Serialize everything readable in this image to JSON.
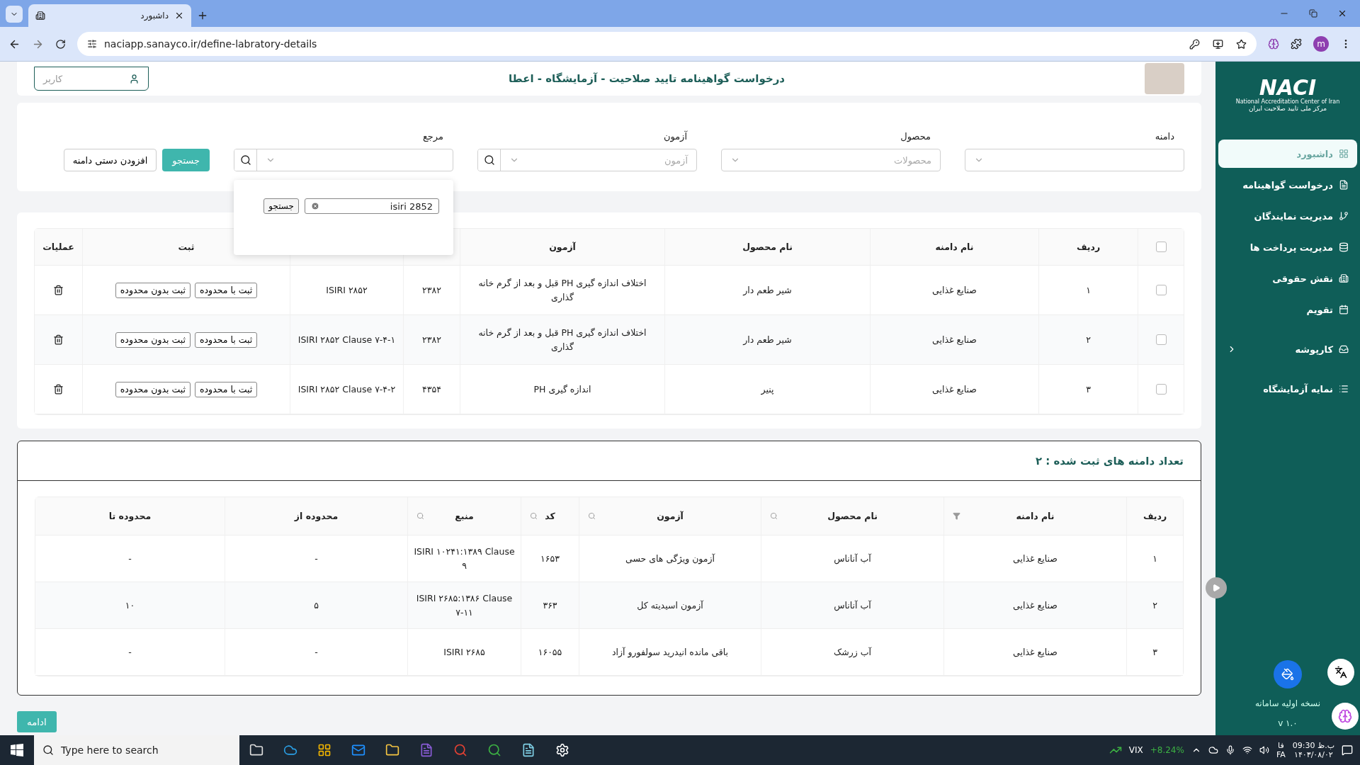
{
  "browser": {
    "tab_title": "داشبورد",
    "url": "naciapp.sanayco.ir/define-labratory-details",
    "profile_initial": "m"
  },
  "header": {
    "user_field": {
      "placeholder": "کاربر"
    },
    "title": "درخواست گواهینامه تایید صلاحیت - آزمایشگاه - اعطا"
  },
  "filters": {
    "fields": [
      {
        "label": "دامنه",
        "kind": "select"
      },
      {
        "label": "محصول",
        "kind": "select",
        "placeholder": "محصولات"
      },
      {
        "label": "آزمون",
        "kind": "search-select",
        "placeholder": "آزمون"
      },
      {
        "label": "مرجع",
        "kind": "search-select",
        "popup": {
          "value": "isiri 2852",
          "button": "جستجو"
        }
      }
    ],
    "search_button": "جستجو",
    "add_button": "افزودن دستی دامنه"
  },
  "domains_table": {
    "header_checked": false,
    "columns": [
      "ردیف",
      "نام دامنه",
      "نام محصول",
      "آزمون",
      null,
      null,
      "ثبت",
      "عملیات"
    ],
    "rows": [
      {
        "checked": false,
        "number": "۱",
        "domain": "صنایع غذایی",
        "product": "شیر طعم دار",
        "test": "اختلاف اندازه گیری PH قبل و بعد از گرم خانه گذاری",
        "code": "۲۳۸۲",
        "source": "ISIRI ۲۸۵۲",
        "buttons": [
          "ثبت با محدوده",
          "ثبت بدون محدوده"
        ]
      },
      {
        "checked": false,
        "number": "۲",
        "domain": "صنایع غذایی",
        "product": "شیر طعم دار",
        "test": "اختلاف اندازه گیری PH قبل و بعد از گرم خانه گذاری",
        "code": "۲۳۸۲",
        "source": "ISIRI ۲۸۵۲ Clause ۷-۴-۱",
        "buttons": [
          "ثبت با محدوده",
          "ثبت بدون محدوده"
        ]
      },
      {
        "checked": false,
        "number": "۳",
        "domain": "صنایع غذایی",
        "product": "پنیر",
        "test": "اندازه گیری PH",
        "code": "۴۳۵۴",
        "source": "ISIRI ۲۸۵۲ Clause ۷-۴-۲",
        "buttons": [
          "ثبت با محدوده",
          "ثبت بدون محدوده"
        ]
      }
    ]
  },
  "registered": {
    "title": "تعداد دامنه های ثبت شده : ۲",
    "columns": [
      {
        "label": "ردیف",
        "searchable": false,
        "filterable": false
      },
      {
        "label": "نام دامنه",
        "searchable": false,
        "filterable": true
      },
      {
        "label": "نام محصول",
        "searchable": true,
        "filterable": false
      },
      {
        "label": "آزمون",
        "searchable": true,
        "filterable": false
      },
      {
        "label": "کد",
        "searchable": true,
        "filterable": false
      },
      {
        "label": "منبع",
        "searchable": true,
        "filterable": false
      },
      {
        "label": "محدوده از",
        "searchable": false,
        "filterable": false
      },
      {
        "label": "محدوده تا",
        "searchable": false,
        "filterable": false
      }
    ],
    "rows": [
      [
        "۱",
        "صنایع غذایی",
        "آب آناناس",
        "آزمون ویژگی های حسی",
        "۱۶۵۳",
        "ISIRI ۱۰۲۴۱:۱۳۸۹ Clause ۹",
        "-",
        "-"
      ],
      [
        "۲",
        "صنایع غذایی",
        "آب آناناس",
        "آزمون اسیدیته کل",
        "۳۶۳",
        "ISIRI ۲۶۸۵:۱۳۸۶ Clause ۷-۱۱",
        "۵",
        "۱۰"
      ],
      [
        "۳",
        "صنایع غذایی",
        "آب زرشک",
        "باقی مانده انیدرید سولفورو آزاد",
        "۱۶۰۵۵",
        "ISIRI ۲۶۸۵",
        "-",
        "-"
      ]
    ]
  },
  "continue_button": "ادامه",
  "sidebar": {
    "logo": {
      "name": "NACI",
      "subtitle_en": "National Accreditation Center of Iran",
      "subtitle_fa": "مرکز ملی تایید صلاحیت ایران"
    },
    "items": [
      {
        "label": "داشبورد",
        "selected": true,
        "expandable": false
      },
      {
        "label": "درخواست گواهینامه",
        "selected": false,
        "expandable": false
      },
      {
        "label": "مدیریت نمایندگان",
        "selected": false,
        "expandable": false
      },
      {
        "label": "مدیریت پرداخت ها",
        "selected": false,
        "expandable": false
      },
      {
        "label": "نقش حقوقی",
        "selected": false,
        "expandable": false
      },
      {
        "label": "تقویم",
        "selected": false,
        "expandable": false
      },
      {
        "label": "کارپوشه",
        "selected": false,
        "expandable": true
      },
      {
        "label": "نمایه آزمایشگاه",
        "selected": false,
        "expandable": false
      }
    ],
    "version_label": "نسخه اولیه سامانه",
    "version": "v ۱.۰"
  },
  "taskbar": {
    "search_placeholder": "Type here to search",
    "ticker": {
      "name": "VIX",
      "change": "+8.24%"
    },
    "time": "ب.ظ 09:30",
    "date": "۱۴۰۳/۰۸/۰۲",
    "language_fa": "فا",
    "language": "FA"
  }
}
